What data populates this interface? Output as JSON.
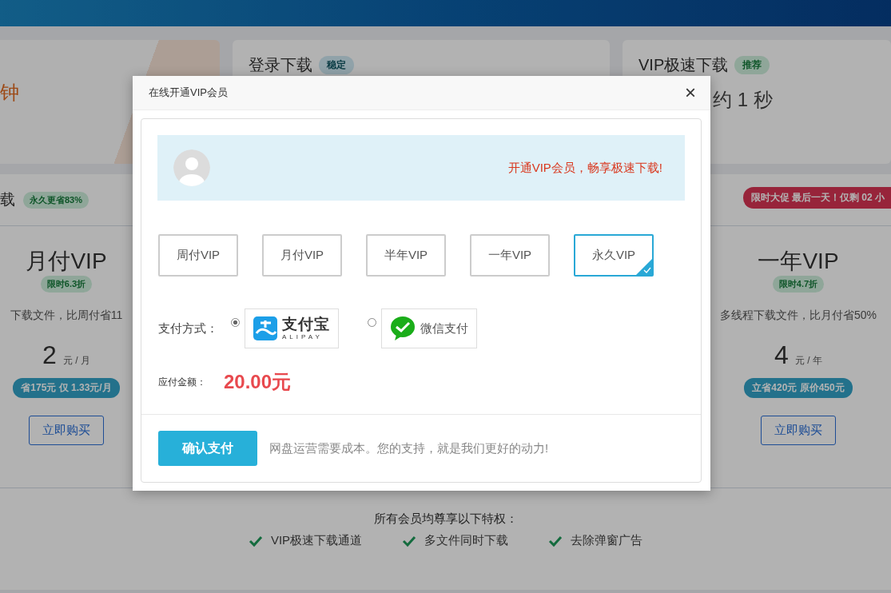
{
  "top_cards": [
    {
      "note": "钟"
    },
    {
      "title": "登录下载",
      "badge": {
        "text": "稳定",
        "kind": "info"
      }
    },
    {
      "title": "VIP极速下载",
      "badge": {
        "text": "推荐",
        "kind": "success"
      },
      "note": "约 1 秒"
    }
  ],
  "pricing": {
    "left_tab": {
      "title": "载",
      "badge": "永久更省83%"
    },
    "promo": "限时大促 最后一天！仅剩 02 小",
    "plans": [
      {
        "name": "月付VIP",
        "discount": "限时6.3折",
        "desc": "下载文件，比周付省11",
        "price": "2",
        "unit": "元 / 月",
        "saving": "省175元 仅 1.33元/月",
        "button": "立即购买"
      },
      {
        "name": "一年VIP",
        "discount": "限时4.7折",
        "desc": "多线程下载文件，比月付省50%",
        "price": "4",
        "unit": "元 / 年",
        "saving": "立省420元 原价450元",
        "button": "立即购买"
      }
    ]
  },
  "perks": {
    "title": "所有会员均尊享以下特权：",
    "items": [
      "VIP极速下载通道",
      "多文件同时下载",
      "去除弹窗广告"
    ]
  },
  "dialog": {
    "title": "在线开通VIP会员",
    "close": "×",
    "slogan": "开通VIP会员，畅享极速下载!",
    "plans": [
      {
        "label": "周付VIP",
        "selected": false
      },
      {
        "label": "月付VIP",
        "selected": false
      },
      {
        "label": "半年VIP",
        "selected": false
      },
      {
        "label": "一年VIP",
        "selected": false
      },
      {
        "label": "永久VIP",
        "selected": true
      }
    ],
    "payment_label": "支付方式：",
    "payment_methods": [
      {
        "kind": "alipay",
        "name": "支付宝",
        "subtitle": "ALIPAY",
        "selected": true
      },
      {
        "kind": "wechat",
        "name": "微信支付",
        "selected": false
      }
    ],
    "amount_label": "应付金额：",
    "amount": "20.00元",
    "confirm": "确认支付",
    "note": "网盘运营需要成本。您的支持，就是我们更好的动力!"
  }
}
